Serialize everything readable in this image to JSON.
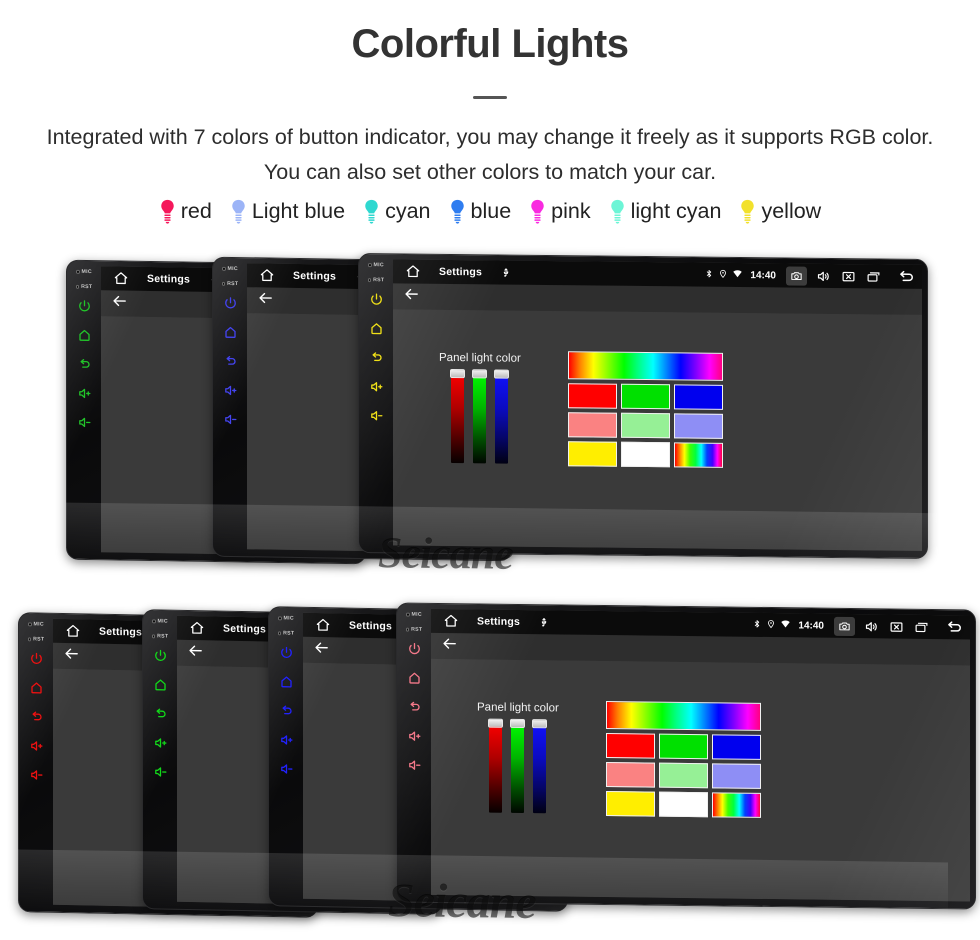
{
  "header": {
    "title": "Colorful Lights",
    "subtitle": "Integrated with 7 colors of button indicator, you may change it freely as it supports RGB color. You can also set other colors to match your car."
  },
  "legend": {
    "items": [
      {
        "label": "red",
        "icon": "bulb-icon",
        "color": "#f5185b"
      },
      {
        "label": "Light blue",
        "icon": "bulb-icon",
        "color": "#9cb4f7"
      },
      {
        "label": "cyan",
        "icon": "bulb-icon",
        "color": "#2fd8d0"
      },
      {
        "label": "blue",
        "icon": "bulb-icon",
        "color": "#2f7df0"
      },
      {
        "label": "pink",
        "icon": "bulb-icon",
        "color": "#f92ae0"
      },
      {
        "label": "light cyan",
        "icon": "bulb-icon",
        "color": "#6df5d6"
      },
      {
        "label": "yellow",
        "icon": "bulb-icon",
        "color": "#f2e12c"
      }
    ]
  },
  "device_ui": {
    "statusbar": {
      "home_icon": "home-icon",
      "title": "Settings",
      "usb_icon": "usb-icon",
      "bluetooth_icon": "bluetooth-icon",
      "location_icon": "location-icon",
      "wifi_icon": "wifi-icon",
      "clock": "14:40",
      "camera_icon": "camera-icon",
      "volume_icon": "volume-icon",
      "close_icon": "close-x-icon",
      "recents_icon": "recent-apps-icon",
      "back_icon": "back-arrow-icon"
    },
    "subbar": {
      "back_icon": "back-arrow-icon"
    },
    "panel": {
      "label": "Panel light color",
      "sliders": [
        {
          "name": "red-slider",
          "color": "#ff0000",
          "value": 100
        },
        {
          "name": "green-slider",
          "color": "#00ff00",
          "value": 100
        },
        {
          "name": "blue-slider",
          "color": "#0000ff",
          "value": 100
        }
      ],
      "palette": {
        "spectrum_bar": "rainbow-spectrum",
        "swatches": [
          [
            "#ff0000",
            "#00e000",
            "#0000ee"
          ],
          [
            "#fa8282",
            "#96f096",
            "#8e8ef5"
          ],
          [
            "#ffee00",
            "#ffffff",
            "rainbow-spectrum"
          ]
        ]
      }
    },
    "side_controls": {
      "mic_label": "MIC",
      "rst_label": "RST",
      "buttons": [
        {
          "name": "power-button",
          "icon": "power-icon"
        },
        {
          "name": "home-button",
          "icon": "home-outline-icon"
        },
        {
          "name": "back-button",
          "icon": "back-curve-icon"
        },
        {
          "name": "volume-up-button",
          "icon": "volume-up-icon"
        },
        {
          "name": "volume-down-button",
          "icon": "volume-down-icon"
        }
      ]
    }
  },
  "groups": [
    {
      "name": "top-row",
      "devices": [
        {
          "name": "device-green",
          "led_color": "#22c32a",
          "active": false
        },
        {
          "name": "device-blue",
          "led_color": "#4444f0",
          "active": false
        },
        {
          "name": "device-yellow",
          "led_color": "#f0e018",
          "active": true
        }
      ]
    },
    {
      "name": "bottom-row",
      "devices": [
        {
          "name": "device-red",
          "led_color": "#ee1111",
          "active": false
        },
        {
          "name": "device-green",
          "led_color": "#12d81a",
          "active": false
        },
        {
          "name": "device-blue",
          "led_color": "#2222ff",
          "active": false
        },
        {
          "name": "device-pink",
          "led_color": "#f4798a",
          "active": true
        }
      ]
    }
  ],
  "watermark": {
    "text": "Seicane"
  }
}
